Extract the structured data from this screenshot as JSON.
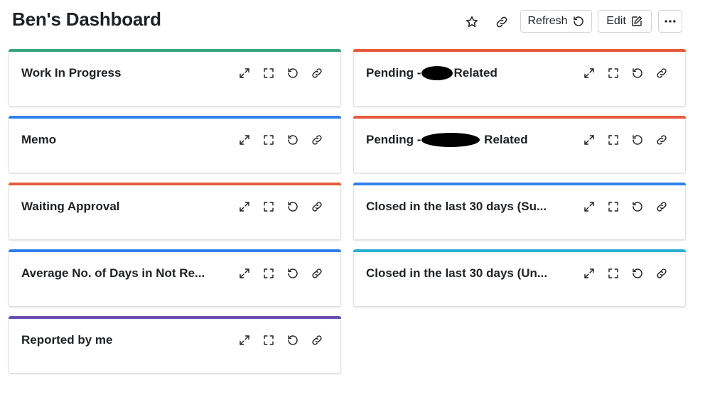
{
  "header": {
    "title": "Ben's Dashboard",
    "refresh_label": "Refresh",
    "edit_label": "Edit"
  },
  "colors": {
    "green": "#3aa57a",
    "red": "#e8593c",
    "blue": "#2f80ed",
    "cyan": "#2bb0d4",
    "purple": "#6a4fb3"
  },
  "cards": [
    {
      "title": "Work In Progress",
      "color": "green"
    },
    {
      "title_pre": "Pending -",
      "title_post": "Related",
      "color": "red"
    },
    {
      "title": "Memo",
      "color": "blue"
    },
    {
      "title_pre": "Pending -",
      "title_post": " Related",
      "color": "red"
    },
    {
      "title": "Waiting Approval",
      "color": "red"
    },
    {
      "title": "Closed in the last 30 days (Su...",
      "color": "blue"
    },
    {
      "title": "Average No. of Days in Not Re...",
      "color": "blue"
    },
    {
      "title": "Closed in the last 30 days (Un...",
      "color": "cyan"
    },
    {
      "title": "Reported by me",
      "color": "purple"
    }
  ],
  "card_icons": [
    "expand-icon",
    "fullscreen-icon",
    "refresh-icon",
    "link-icon"
  ]
}
